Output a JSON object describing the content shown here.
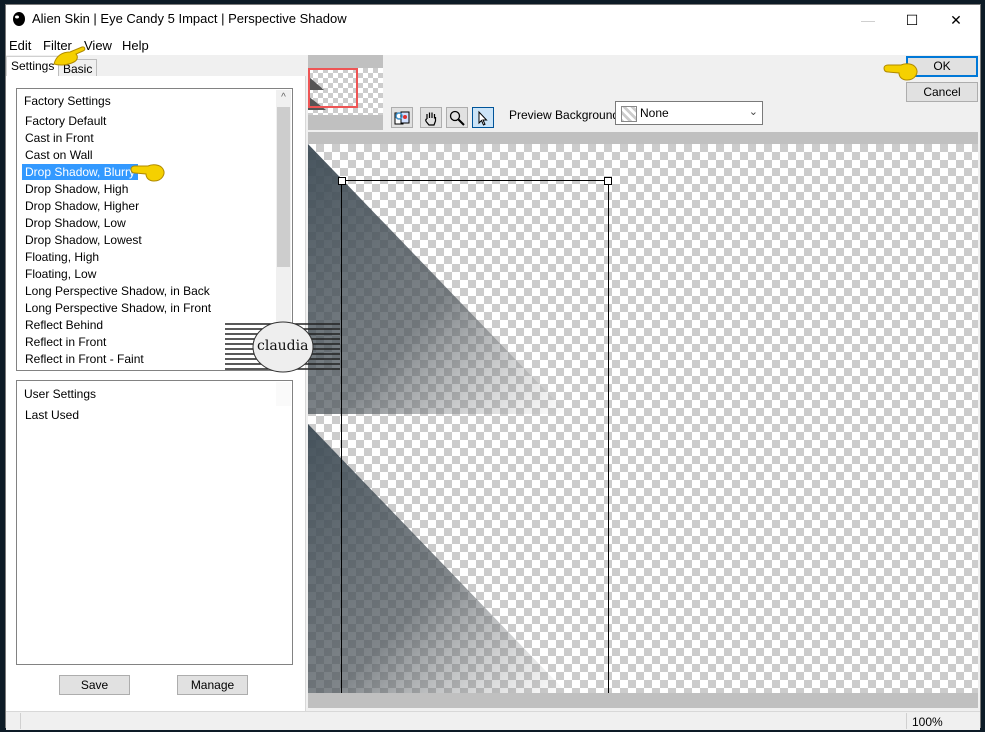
{
  "window": {
    "title": "Alien Skin | Eye Candy 5 Impact | Perspective Shadow",
    "controls": {
      "minimize": "—",
      "maximize": "☐",
      "close": "✕"
    }
  },
  "menubar": {
    "items": [
      "Edit",
      "Filter",
      "View",
      "Help"
    ]
  },
  "tabs": [
    {
      "label": "Settings",
      "active": true
    },
    {
      "label": "Basic",
      "active": false
    }
  ],
  "factory_settings": {
    "header": "Factory Settings",
    "items": [
      "Factory Default",
      "Cast in Front",
      "Cast on Wall",
      "Drop Shadow, Blurry",
      "Drop Shadow, High",
      "Drop Shadow, Higher",
      "Drop Shadow, Low",
      "Drop Shadow, Lowest",
      "Floating, High",
      "Floating, Low",
      "Long Perspective Shadow, in Back",
      "Long Perspective Shadow, in Front",
      "Reflect Behind",
      "Reflect in Front",
      "Reflect in Front - Faint"
    ],
    "selected": "Drop Shadow, Blurry"
  },
  "user_settings": {
    "header": "User Settings",
    "items": [
      "Last Used"
    ]
  },
  "buttons": {
    "save": "Save",
    "manage": "Manage",
    "ok": "OK",
    "cancel": "Cancel"
  },
  "toolbar": {
    "tools": [
      "preview-compare",
      "hand",
      "zoom",
      "pointer"
    ],
    "active_tool": "pointer"
  },
  "preview_background": {
    "label": "Preview Background:",
    "value": "None"
  },
  "status": {
    "zoom": "100%"
  },
  "watermark": {
    "text": "claudia"
  },
  "colors": {
    "selection": "#3399ff",
    "default_button_border": "#0078d7",
    "thumbnail_frame": "#ee5555",
    "shadow": "#3d4b55"
  }
}
